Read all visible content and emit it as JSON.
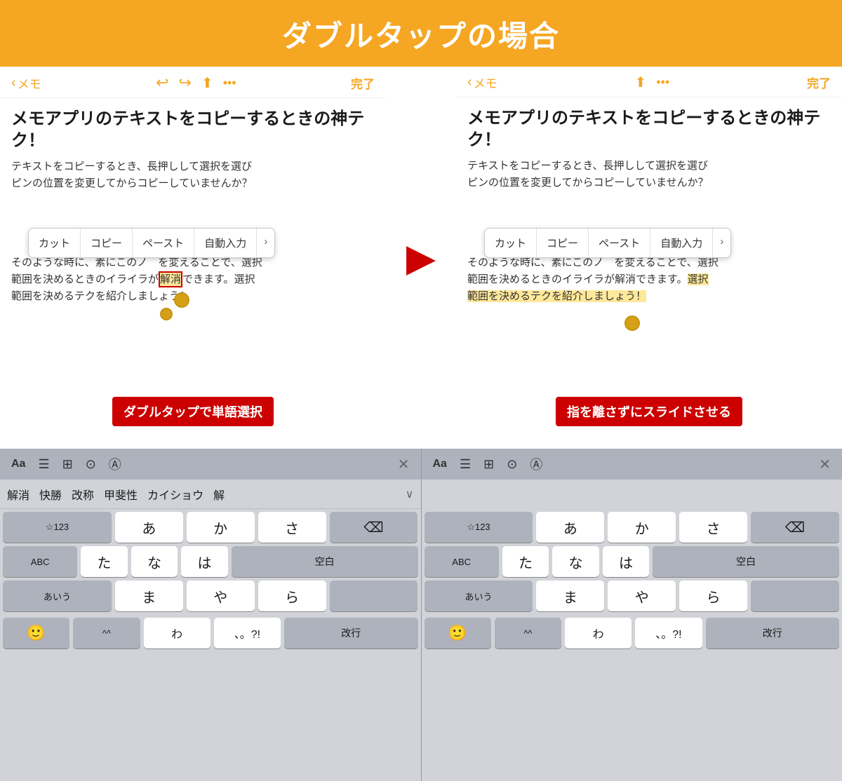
{
  "header": {
    "title": "ダブルタップの場合"
  },
  "left_panel": {
    "nav": {
      "back_label": "メモ",
      "done_label": "完了"
    },
    "note": {
      "title": "メモアプリのテキストをコピーするときの神テク！",
      "body_line1": "テキストをコピーするとき、長押しして選択を選び",
      "body_line2": "ピンの位置を変更してからコピーしていませんか？",
      "body_line3": "そのような時に、素にこのノ　を変えることで、選択",
      "body_line4": "範囲を決めるときのイライラが解消できます。選択",
      "body_line5": "範囲を決めるテクを紹介しましょう！"
    },
    "context_menu": {
      "items": [
        "カット",
        "コピー",
        "ペースト",
        "自動入力"
      ]
    },
    "label": "ダブルタップで単語選択"
  },
  "right_panel": {
    "nav": {
      "back_label": "メモ",
      "done_label": "完了"
    },
    "note": {
      "title": "メモアプリのテキストをコピーするときの神テク！",
      "body_line1": "テキストをコピーするとき、長押しして選択を選び",
      "body_line2": "ピンの位置を変更してからコピーしていませんか？",
      "body_line3": "そのような時に、素にこのノ　を変えることで、選択",
      "body_line4": "範囲を決めるときのイライラが解消できます。選択",
      "body_line5": "範囲を決めるテクを紹介しましょう！"
    },
    "context_menu": {
      "items": [
        "カット",
        "コピー",
        "ペースト",
        "自動入力"
      ]
    },
    "label": "指を離さずにスライドさせる"
  },
  "keyboard_left": {
    "toolbar": {
      "aa_label": "Aa",
      "icons": [
        "list-icon",
        "grid-icon",
        "camera-icon",
        "circle-a-icon",
        "close-icon"
      ]
    },
    "predictions": [
      "解消",
      "快勝",
      "改称",
      "甲斐性",
      "カイショウ",
      "解"
    ],
    "rows": [
      [
        "☆123",
        "あ",
        "か",
        "さ",
        "⌫"
      ],
      [
        "ABC",
        "た",
        "な",
        "は",
        "空白"
      ],
      [
        "あいう",
        "ま",
        "や",
        "ら",
        ""
      ],
      [
        "😊",
        "^^",
        "わ",
        "、。?!",
        "改行"
      ]
    ]
  },
  "keyboard_right": {
    "toolbar": {
      "aa_label": "Aa",
      "icons": [
        "list-icon",
        "grid-icon",
        "camera-icon",
        "circle-a-icon",
        "close-icon"
      ]
    },
    "rows": [
      [
        "☆123",
        "あ",
        "か",
        "さ",
        "⌫"
      ],
      [
        "ABC",
        "た",
        "な",
        "は",
        "空白"
      ],
      [
        "あいう",
        "ま",
        "や",
        "ら",
        ""
      ],
      [
        "😊",
        "^^",
        "わ",
        "、。?!",
        "改行"
      ]
    ]
  },
  "arrow": "→",
  "colors": {
    "orange": "#f5a623",
    "red": "#cc0000",
    "selection_yellow": "#ffe89a"
  }
}
